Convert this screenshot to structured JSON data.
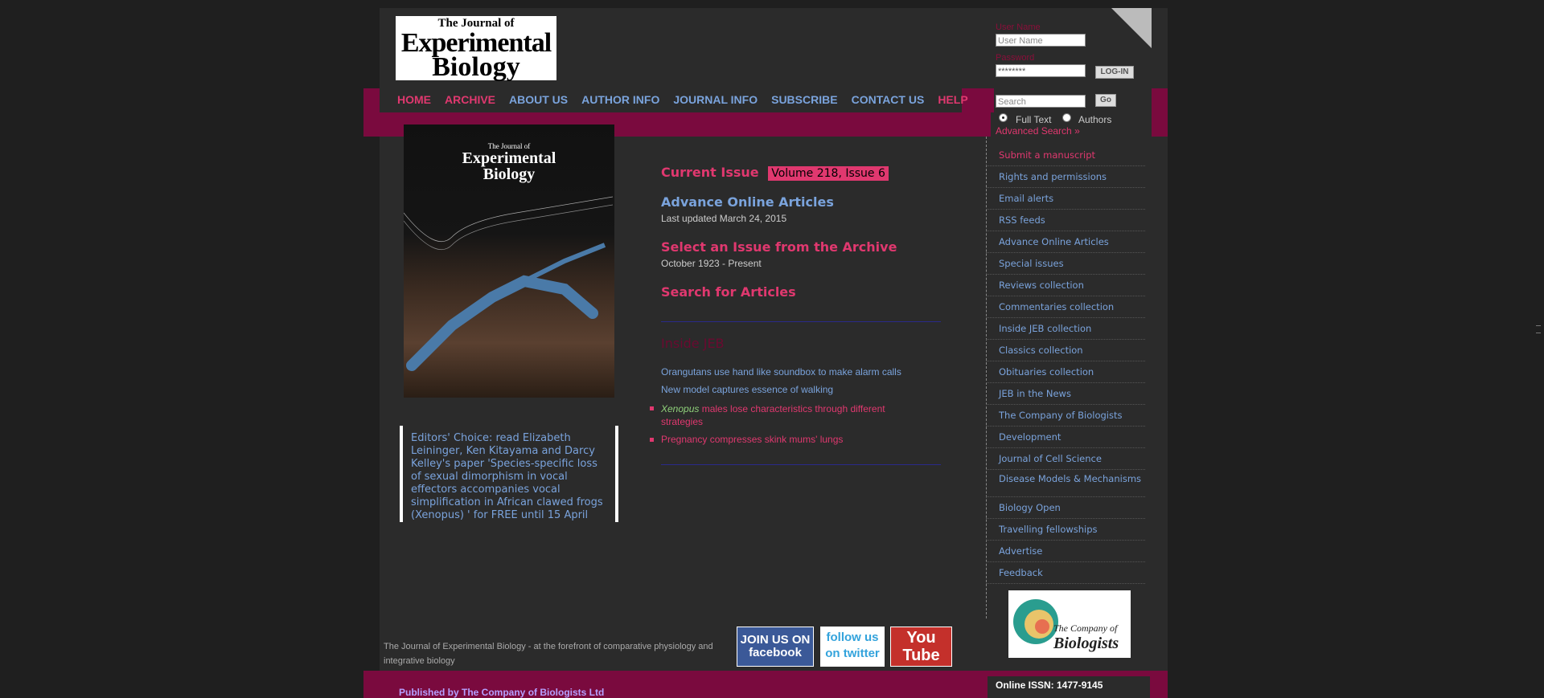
{
  "header": {
    "logo": {
      "line1": "The Journal of",
      "line2": "Experimental",
      "line3": "Biology"
    },
    "login": {
      "username_label": "User Name",
      "username_placeholder": "User Name",
      "password_label": "Password",
      "password_value": "********",
      "login_button": "LOG-IN"
    },
    "search": {
      "placeholder": "Search",
      "go_button": "Go",
      "radio_fulltext": "Full Text",
      "radio_authors": "Authors",
      "advanced_link": "Advanced Search »"
    }
  },
  "nav": [
    {
      "label": "HOME"
    },
    {
      "label": "ARCHIVE"
    },
    {
      "label": "ABOUT US"
    },
    {
      "label": "AUTHOR INFO"
    },
    {
      "label": "JOURNAL INFO"
    },
    {
      "label": "SUBSCRIBE"
    },
    {
      "label": "CONTACT US"
    },
    {
      "label": "HELP"
    }
  ],
  "cover": {
    "line1": "The Journal of",
    "line2": "Experimental",
    "line3": "Biology"
  },
  "editors_choice": "Editors' Choice: read Elizabeth Leininger, Ken Kitayama and Darcy Kelley's paper 'Species-specific loss of sexual dimorphism in vocal effectors accompanies vocal simplification in African clawed frogs (Xenopus) ' for FREE until 15 April",
  "main": {
    "current_issue_label": "Current Issue",
    "current_issue_volume": "Volume 218, Issue 6",
    "advance_title": "Advance Online Articles",
    "advance_sub": "Last updated March 24, 2015",
    "archive_title": "Select an Issue from the Archive",
    "archive_sub": "October 1923 - Present",
    "search_title": "Search for Articles",
    "inside_title": "Inside JEB",
    "news": [
      "Orangutans use hand like soundbox to make alarm calls",
      "New model captures essence of walking"
    ],
    "news_bullets": [
      {
        "italic": "Xenopus",
        "rest": " males lose characteristics through different strategies"
      },
      {
        "italic": "",
        "rest": "Pregnancy compresses skink mums' lungs"
      }
    ]
  },
  "sidebar": [
    "Submit a manuscript",
    "Rights and permissions",
    "Email alerts",
    "RSS feeds",
    "Advance Online Articles",
    "Special issues",
    "Reviews collection",
    "Commentaries collection",
    "Inside JEB collection",
    "Classics collection",
    "Obituaries collection",
    "JEB in the News",
    "The Company of Biologists",
    "Development",
    "Journal of Cell Science",
    "Disease Models & Mechanisms",
    "Biology Open",
    "Travelling fellowships",
    "Advertise",
    "Feedback"
  ],
  "cob_logo": {
    "line1": "The Company of",
    "line2": "Biologists"
  },
  "social": {
    "facebook": "JOIN US ON facebook",
    "twitter": "follow us on twitter",
    "youtube": "You Tube"
  },
  "footer": {
    "tagline": "The Journal of Experimental Biology - at the forefront of comparative physiology and integrative biology",
    "published": "Published by The Company of Biologists Ltd",
    "issn": "Online ISSN: 1477-9145"
  },
  "colors": {
    "accent_pink": "#e0386f",
    "accent_blue": "#7aa3dc",
    "band": "#7a0a3e"
  }
}
